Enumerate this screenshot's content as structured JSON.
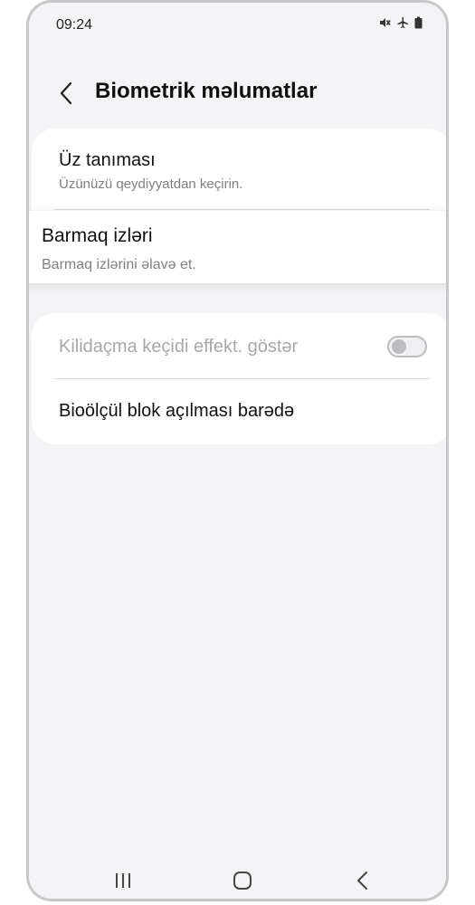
{
  "status_bar": {
    "time": "09:24",
    "icons": [
      "mute-icon",
      "airplane-icon",
      "battery-icon"
    ]
  },
  "header": {
    "title": "Biometrik məlumatlar",
    "back_icon": "chevron-left-icon"
  },
  "biometrics": {
    "face": {
      "title": "Üz tanıması",
      "subtitle": "Üzünüzü qeydiyyatdan keçirin."
    },
    "fingerprint": {
      "title": "Barmaq izləri",
      "subtitle": "Barmaq izlərini əlavə et."
    }
  },
  "settings": {
    "unlock_transition": {
      "label": "Kilidaçma keçidi effekt. göstər",
      "enabled": false
    },
    "about": {
      "label": "Bioölçül blok açılması barədə"
    }
  },
  "nav_bar": {
    "buttons": [
      "recent-apps-icon",
      "home-icon",
      "back-icon"
    ]
  },
  "colors": {
    "background": "#f4f4f6",
    "card": "#ffffff",
    "title_text": "#111111",
    "subtitle_text": "#808080",
    "disabled_text": "#a8a8aa"
  }
}
